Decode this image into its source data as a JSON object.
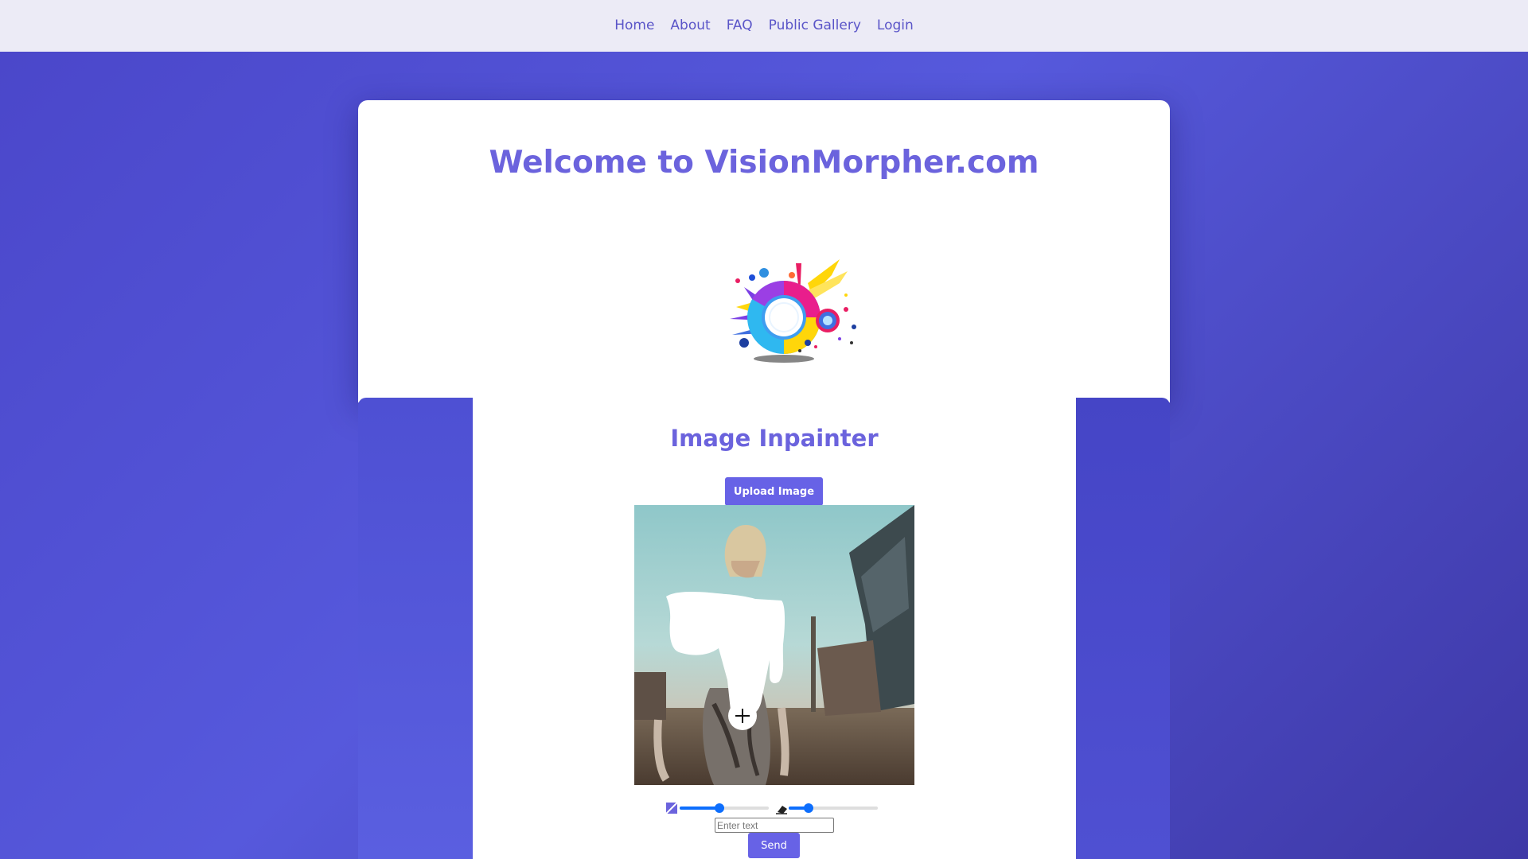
{
  "nav": {
    "items": [
      {
        "label": "Home"
      },
      {
        "label": "About"
      },
      {
        "label": "FAQ"
      },
      {
        "label": "Public Gallery"
      },
      {
        "label": "Login"
      }
    ]
  },
  "hero": {
    "title": "Welcome to VisionMorpher.com",
    "logo_icon": "vision-swirl-logo"
  },
  "inpainter": {
    "title": "Image Inpainter",
    "upload_label": "Upload Image",
    "image_description_icon": "uploaded-photo",
    "brush_icon": "brush-size-icon",
    "brush_size_percent": 44,
    "eraser_icon": "eraser-icon",
    "eraser_size_percent": 22,
    "text_placeholder": "Enter text",
    "text_value": "",
    "send_label": "Send"
  },
  "colors": {
    "accent": "#6762e6",
    "title": "#6b63dd",
    "nav_bg": "#ecebf6",
    "nav_link": "#5a55c8",
    "slider": "#0d6efd"
  }
}
